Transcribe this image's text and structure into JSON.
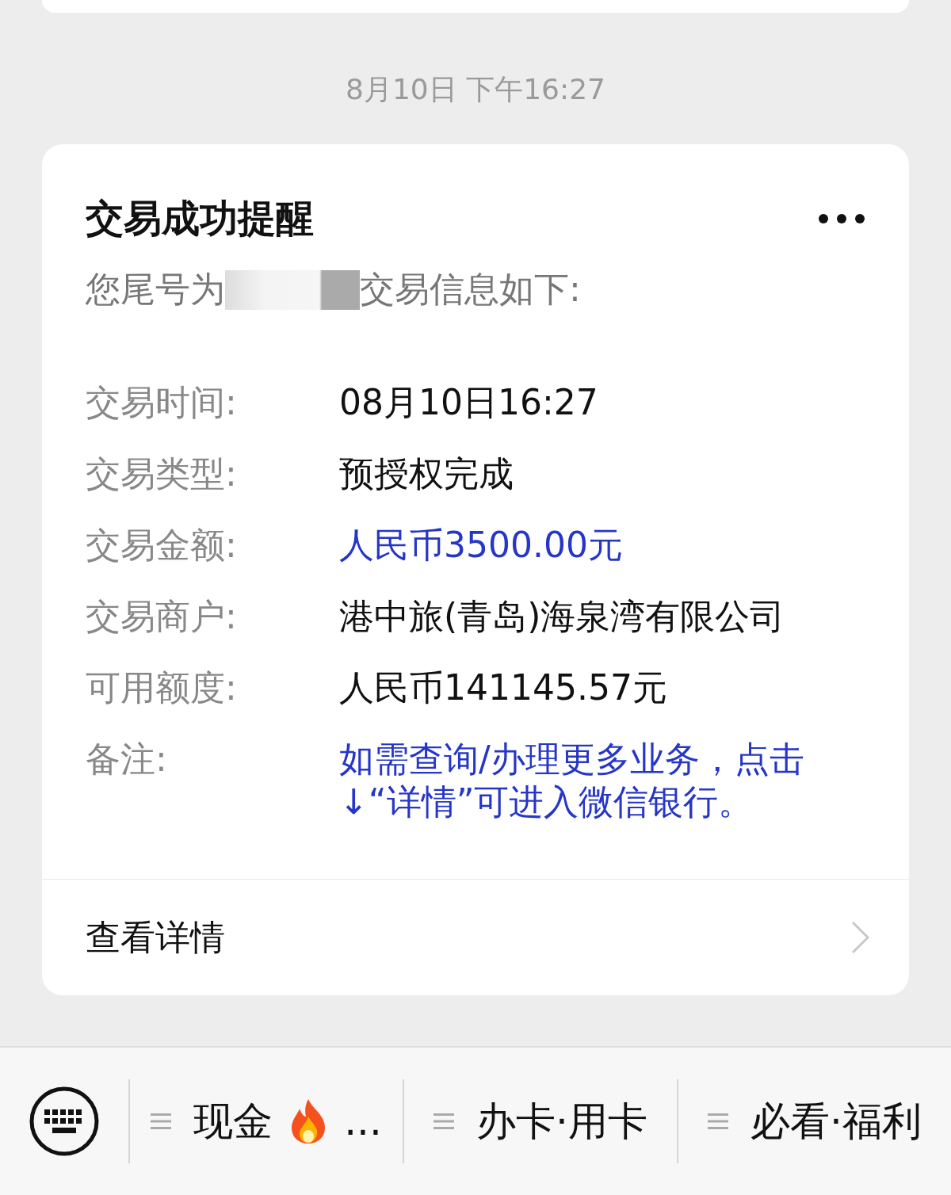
{
  "timestamp": "8月10日 下午16:27",
  "card": {
    "title": "交易成功提醒",
    "subtitle_start": "您尾号为",
    "subtitle_end": "交易信息如下:",
    "rows": [
      {
        "label": "交易时间:",
        "value": "08月10日16:27",
        "kind": "plain"
      },
      {
        "label": "交易类型:",
        "value": "预授权完成",
        "kind": "plain"
      },
      {
        "label": "交易金额:",
        "value": "人民币3500.00元",
        "kind": "highlight"
      },
      {
        "label": "交易商户:",
        "value": "港中旅(青岛)海泉湾有限公司",
        "kind": "plain"
      },
      {
        "label": "可用额度:",
        "value": "人民币141145.57元",
        "kind": "plain"
      },
      {
        "label": "备注:",
        "value": "如需查询/办理更多业务，点击↓“详情”可进入微信银行。",
        "kind": "highlight"
      }
    ],
    "footer_link": "查看详情"
  },
  "menu_bar": {
    "items": [
      {
        "label": "现金",
        "suffix": "...",
        "fire": true
      },
      {
        "label": "办卡·用卡",
        "fire": false
      },
      {
        "label": "必看·福利",
        "fire": false
      }
    ]
  }
}
